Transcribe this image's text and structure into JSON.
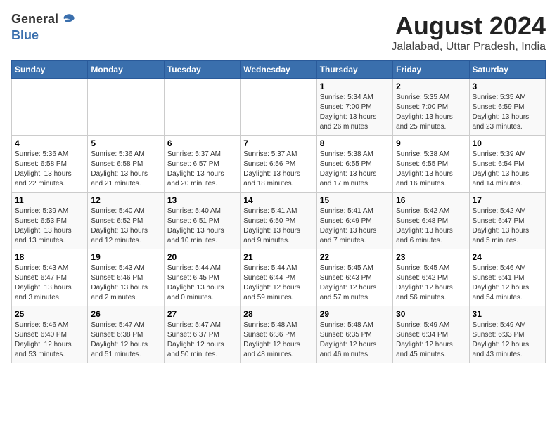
{
  "header": {
    "logo_line1": "General",
    "logo_line2": "Blue",
    "month_year": "August 2024",
    "location": "Jalalabad, Uttar Pradesh, India"
  },
  "days_of_week": [
    "Sunday",
    "Monday",
    "Tuesday",
    "Wednesday",
    "Thursday",
    "Friday",
    "Saturday"
  ],
  "weeks": [
    [
      {
        "day": "",
        "info": ""
      },
      {
        "day": "",
        "info": ""
      },
      {
        "day": "",
        "info": ""
      },
      {
        "day": "",
        "info": ""
      },
      {
        "day": "1",
        "info": "Sunrise: 5:34 AM\nSunset: 7:00 PM\nDaylight: 13 hours\nand 26 minutes."
      },
      {
        "day": "2",
        "info": "Sunrise: 5:35 AM\nSunset: 7:00 PM\nDaylight: 13 hours\nand 25 minutes."
      },
      {
        "day": "3",
        "info": "Sunrise: 5:35 AM\nSunset: 6:59 PM\nDaylight: 13 hours\nand 23 minutes."
      }
    ],
    [
      {
        "day": "4",
        "info": "Sunrise: 5:36 AM\nSunset: 6:58 PM\nDaylight: 13 hours\nand 22 minutes."
      },
      {
        "day": "5",
        "info": "Sunrise: 5:36 AM\nSunset: 6:58 PM\nDaylight: 13 hours\nand 21 minutes."
      },
      {
        "day": "6",
        "info": "Sunrise: 5:37 AM\nSunset: 6:57 PM\nDaylight: 13 hours\nand 20 minutes."
      },
      {
        "day": "7",
        "info": "Sunrise: 5:37 AM\nSunset: 6:56 PM\nDaylight: 13 hours\nand 18 minutes."
      },
      {
        "day": "8",
        "info": "Sunrise: 5:38 AM\nSunset: 6:55 PM\nDaylight: 13 hours\nand 17 minutes."
      },
      {
        "day": "9",
        "info": "Sunrise: 5:38 AM\nSunset: 6:55 PM\nDaylight: 13 hours\nand 16 minutes."
      },
      {
        "day": "10",
        "info": "Sunrise: 5:39 AM\nSunset: 6:54 PM\nDaylight: 13 hours\nand 14 minutes."
      }
    ],
    [
      {
        "day": "11",
        "info": "Sunrise: 5:39 AM\nSunset: 6:53 PM\nDaylight: 13 hours\nand 13 minutes."
      },
      {
        "day": "12",
        "info": "Sunrise: 5:40 AM\nSunset: 6:52 PM\nDaylight: 13 hours\nand 12 minutes."
      },
      {
        "day": "13",
        "info": "Sunrise: 5:40 AM\nSunset: 6:51 PM\nDaylight: 13 hours\nand 10 minutes."
      },
      {
        "day": "14",
        "info": "Sunrise: 5:41 AM\nSunset: 6:50 PM\nDaylight: 13 hours\nand 9 minutes."
      },
      {
        "day": "15",
        "info": "Sunrise: 5:41 AM\nSunset: 6:49 PM\nDaylight: 13 hours\nand 7 minutes."
      },
      {
        "day": "16",
        "info": "Sunrise: 5:42 AM\nSunset: 6:48 PM\nDaylight: 13 hours\nand 6 minutes."
      },
      {
        "day": "17",
        "info": "Sunrise: 5:42 AM\nSunset: 6:47 PM\nDaylight: 13 hours\nand 5 minutes."
      }
    ],
    [
      {
        "day": "18",
        "info": "Sunrise: 5:43 AM\nSunset: 6:47 PM\nDaylight: 13 hours\nand 3 minutes."
      },
      {
        "day": "19",
        "info": "Sunrise: 5:43 AM\nSunset: 6:46 PM\nDaylight: 13 hours\nand 2 minutes."
      },
      {
        "day": "20",
        "info": "Sunrise: 5:44 AM\nSunset: 6:45 PM\nDaylight: 13 hours\nand 0 minutes."
      },
      {
        "day": "21",
        "info": "Sunrise: 5:44 AM\nSunset: 6:44 PM\nDaylight: 12 hours\nand 59 minutes."
      },
      {
        "day": "22",
        "info": "Sunrise: 5:45 AM\nSunset: 6:43 PM\nDaylight: 12 hours\nand 57 minutes."
      },
      {
        "day": "23",
        "info": "Sunrise: 5:45 AM\nSunset: 6:42 PM\nDaylight: 12 hours\nand 56 minutes."
      },
      {
        "day": "24",
        "info": "Sunrise: 5:46 AM\nSunset: 6:41 PM\nDaylight: 12 hours\nand 54 minutes."
      }
    ],
    [
      {
        "day": "25",
        "info": "Sunrise: 5:46 AM\nSunset: 6:40 PM\nDaylight: 12 hours\nand 53 minutes."
      },
      {
        "day": "26",
        "info": "Sunrise: 5:47 AM\nSunset: 6:38 PM\nDaylight: 12 hours\nand 51 minutes."
      },
      {
        "day": "27",
        "info": "Sunrise: 5:47 AM\nSunset: 6:37 PM\nDaylight: 12 hours\nand 50 minutes."
      },
      {
        "day": "28",
        "info": "Sunrise: 5:48 AM\nSunset: 6:36 PM\nDaylight: 12 hours\nand 48 minutes."
      },
      {
        "day": "29",
        "info": "Sunrise: 5:48 AM\nSunset: 6:35 PM\nDaylight: 12 hours\nand 46 minutes."
      },
      {
        "day": "30",
        "info": "Sunrise: 5:49 AM\nSunset: 6:34 PM\nDaylight: 12 hours\nand 45 minutes."
      },
      {
        "day": "31",
        "info": "Sunrise: 5:49 AM\nSunset: 6:33 PM\nDaylight: 12 hours\nand 43 minutes."
      }
    ]
  ]
}
